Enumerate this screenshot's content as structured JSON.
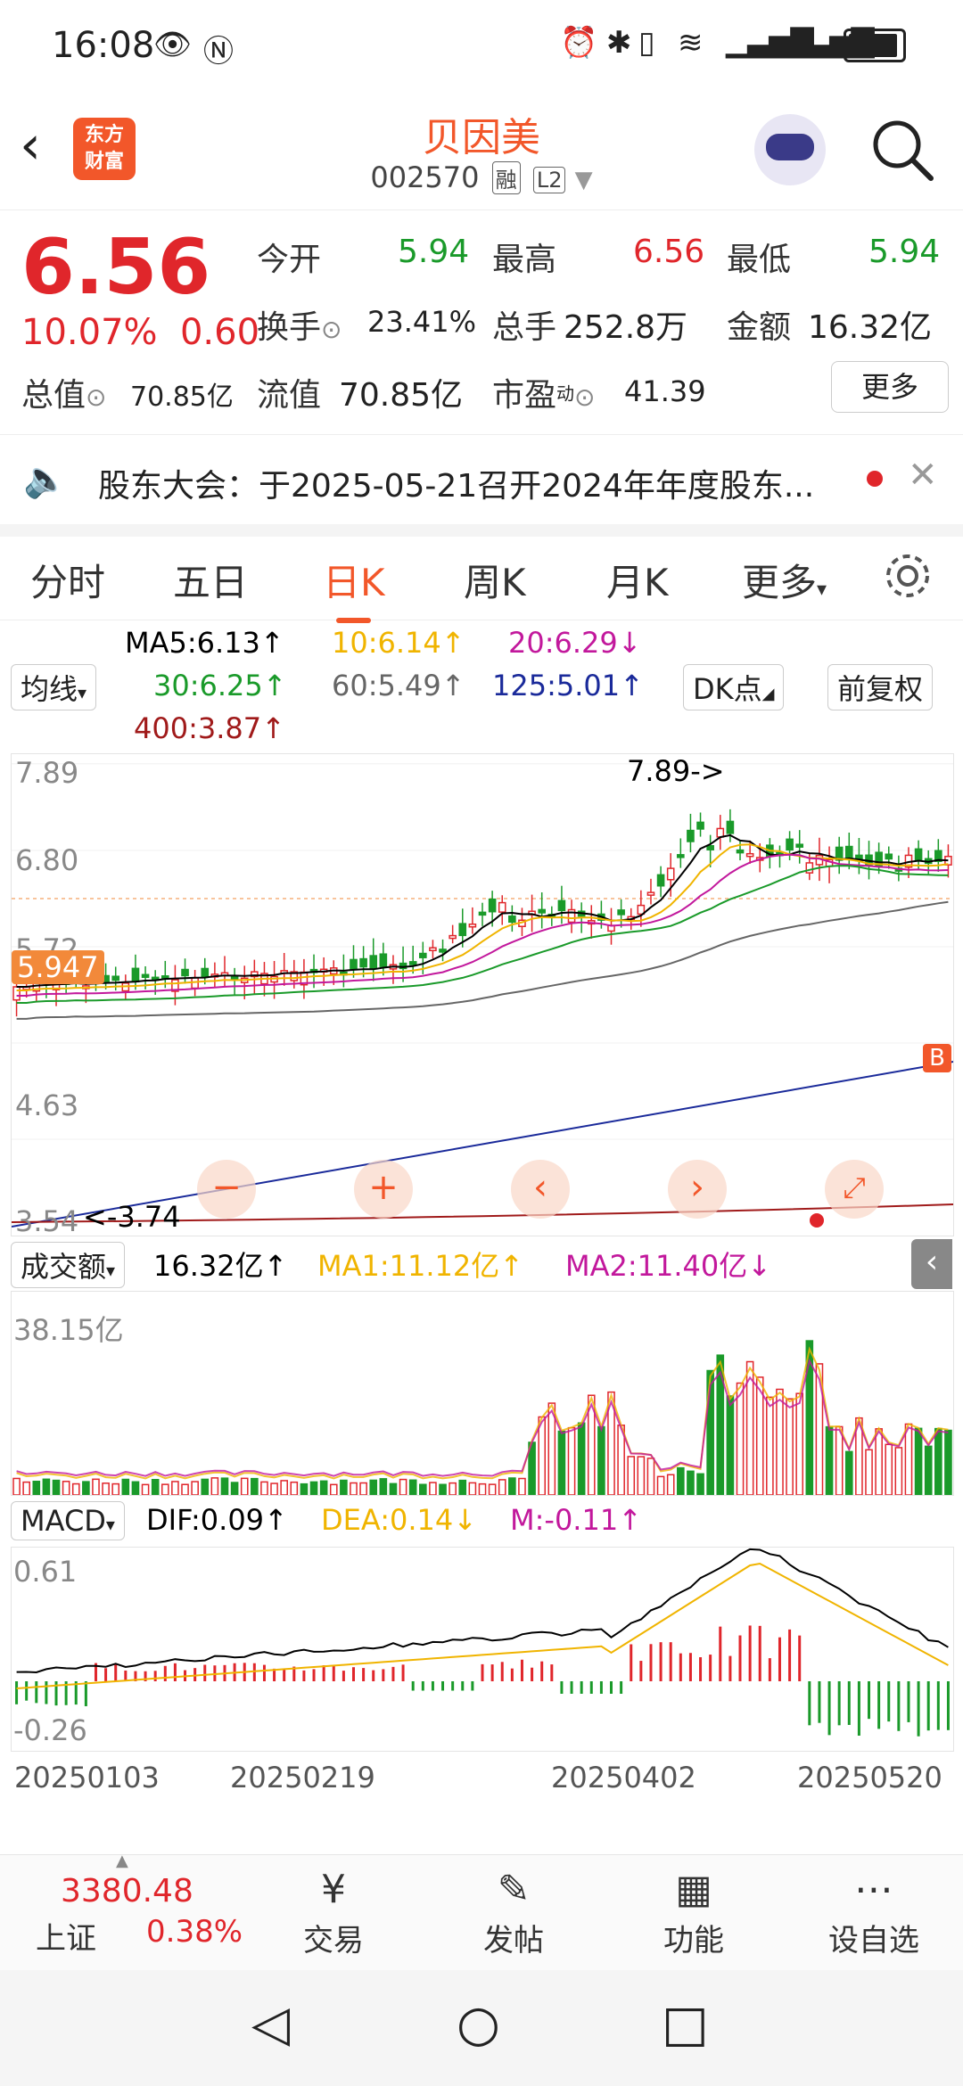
{
  "status": {
    "time": "16:08"
  },
  "header": {
    "logo": "东方\n财富",
    "title": "贝因美",
    "code": "002570",
    "tag1": "融",
    "tag2": "L2"
  },
  "quote": {
    "price": "6.56",
    "pct": "10.07%",
    "chg": "0.60",
    "open_label": "今开",
    "open": "5.94",
    "high_label": "最高",
    "high": "6.56",
    "low_label": "最低",
    "low": "5.94",
    "turnover_label": "换手",
    "turnover": "23.41%",
    "volume_label": "总手",
    "volume": "252.8万",
    "amount_label": "金额",
    "amount": "16.32亿",
    "mktcap_label": "总值",
    "mktcap": "70.85亿",
    "float_label": "流值",
    "float": "70.85亿",
    "pe_label": "市盈",
    "pe_sup": "动",
    "pe": "41.39",
    "more": "更多"
  },
  "notice": {
    "text": "股东大会：于2025-05-21召开2024年年度股东..."
  },
  "tabs": [
    "分时",
    "五日",
    "日K",
    "周K",
    "月K",
    "更多"
  ],
  "ma": {
    "selector": "均线",
    "ma5": "MA5:6.13↑",
    "ma10": "10:6.14↑",
    "ma20": "20:6.29↓",
    "ma30": "30:6.25↑",
    "ma60": "60:5.49↑",
    "ma125": "125:5.01↑",
    "ma400": "400:3.87↑",
    "dk": "DK点",
    "fq": "前复权"
  },
  "kline": {
    "ymax": "7.89",
    "y2": "6.80",
    "y3": "5.72",
    "y4": "4.63",
    "y5": "3.54",
    "current": "5.947",
    "peak_label": "7.89->",
    "low_label": "<-3.74",
    "b_mark": "B"
  },
  "volume": {
    "selector": "成交额",
    "total": "16.32亿↑",
    "ma1": "MA1:11.12亿↑",
    "ma2": "MA2:11.40亿↓",
    "ymax": "38.15亿"
  },
  "macd": {
    "selector": "MACD",
    "dif": "DIF:0.09↑",
    "dea": "DEA:0.14↓",
    "m": "M:-0.11↑",
    "ymax": "0.61",
    "ymin": "-0.26"
  },
  "dates": [
    "20250103",
    "20250219",
    "20250402",
    "20250520"
  ],
  "bottom": {
    "index_value": "3380.48",
    "index_name": "上证",
    "index_pct": "0.38%",
    "trade": "交易",
    "post": "发帖",
    "func": "功能",
    "watch": "设自选"
  },
  "colors": {
    "up": "#e0262b",
    "down": "#1a9a2a",
    "accent": "#f2572a",
    "ma5": "#000000",
    "ma10": "#f0b400",
    "ma20": "#c2189c",
    "ma30": "#1a9a2a",
    "ma60": "#666666",
    "ma125": "#1a2a9a",
    "ma400": "#a01a1a"
  }
}
